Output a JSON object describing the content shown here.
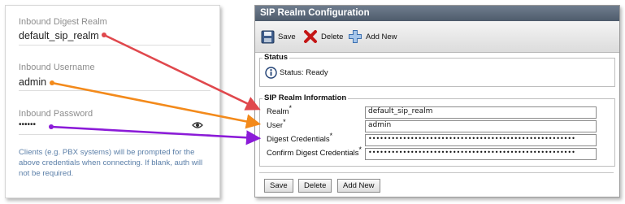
{
  "left_form": {
    "fields": [
      {
        "label": "Inbound Digest Realm",
        "value": "default_sip_realm"
      },
      {
        "label": "Inbound Username",
        "value": "admin"
      },
      {
        "label": "Inbound Password",
        "value": "••••••"
      }
    ],
    "help_text": "Clients (e.g. PBX systems) will be prompted for the above credentials when connecting. If blank, auth will not be required."
  },
  "panel": {
    "title": "SIP Realm Configuration",
    "toolbar": {
      "save": "Save",
      "delete": "Delete",
      "add_new": "Add New"
    },
    "status": {
      "legend": "Status",
      "text": "Status: Ready"
    },
    "info": {
      "legend": "SIP Realm Information",
      "fields": [
        {
          "label": "Realm",
          "value": "default_sip_realm"
        },
        {
          "label": "User",
          "value": "admin"
        },
        {
          "label": "Digest Credentials",
          "value": "••••••••••••••••••••••••••••••••••••••••••••••••••••••"
        },
        {
          "label": "Confirm Digest Credentials",
          "value": "••••••••••••••••••••••••••••••••••••••••••••••••••••••"
        }
      ],
      "required_mark": "*"
    },
    "buttons": {
      "save": "Save",
      "delete": "Delete",
      "add_new": "Add New"
    }
  },
  "colors": {
    "arrow_realm": "#e0484d",
    "arrow_user": "#f38a1b",
    "arrow_password": "#8b1bd8",
    "help_text": "#5b7fa8",
    "title_bar": "#56636f"
  },
  "icons": [
    "eye-icon",
    "save-icon",
    "delete-x-icon",
    "add-new-plus-icon",
    "info-icon"
  ]
}
